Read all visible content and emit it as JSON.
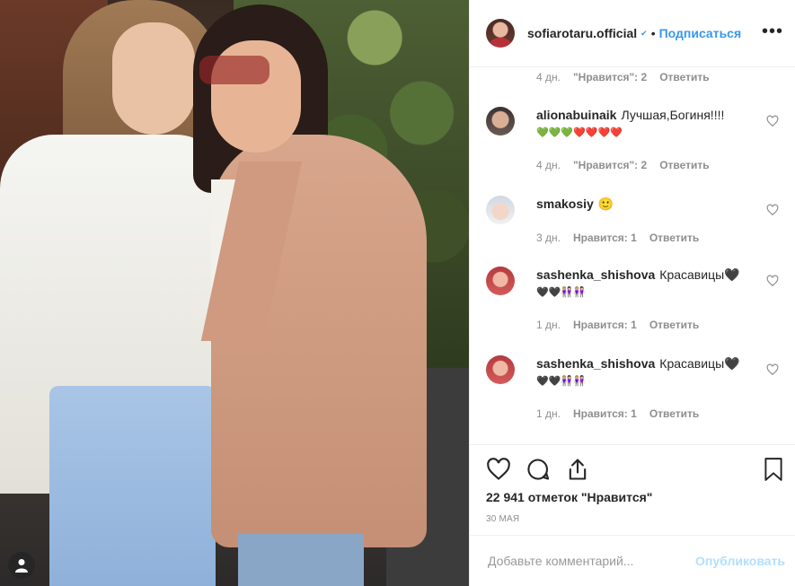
{
  "post": {
    "username": "sofiarotaru.official",
    "verified_mark": "✔",
    "separator": "•",
    "follow_label": "Подписаться",
    "more_label": "•••"
  },
  "first_meta": {
    "age": "4 дн.",
    "likes": "\"Нравится\": 2",
    "reply": "Ответить"
  },
  "comments": [
    {
      "username": "alionabuinaik",
      "text": "Лучшая,Богиня!!!!",
      "emoji_line": "💚💚💚❤️❤️❤️❤️",
      "age": "4 дн.",
      "likes": "\"Нравится\": 2",
      "reply": "Ответить"
    },
    {
      "username": "smakosiy",
      "text": "🙂",
      "age": "3 дн.",
      "likes": "Нравится: 1",
      "reply": "Ответить"
    },
    {
      "username": "sashenka_shishova",
      "text": "Красавицы🖤",
      "emoji_line": "🖤🖤👩🏼‍🤝‍👩🏻👩🏼‍🤝‍👩🏻",
      "age": "1 дн.",
      "likes": "Нравится: 1",
      "reply": "Ответить"
    },
    {
      "username": "sashenka_shishova",
      "text": "Красавицы🖤",
      "emoji_line": "🖤🖤👩🏼‍🤝‍👩🏻👩🏼‍🤝‍👩🏻",
      "age": "1 дн.",
      "likes": "Нравится: 1",
      "reply": "Ответить"
    }
  ],
  "actions": {
    "icons": [
      "heart-icon",
      "comment-icon",
      "share-icon",
      "bookmark-icon"
    ],
    "likes_count": "22 941 отметок \"Нравится\"",
    "date": "30 МАЯ"
  },
  "add_comment": {
    "placeholder": "Добавьте комментарий...",
    "publish_label": "Опубликовать"
  },
  "colors": {
    "link": "#3897f0",
    "muted": "#8e8e8e",
    "publish_disabled": "#b2dffc"
  }
}
